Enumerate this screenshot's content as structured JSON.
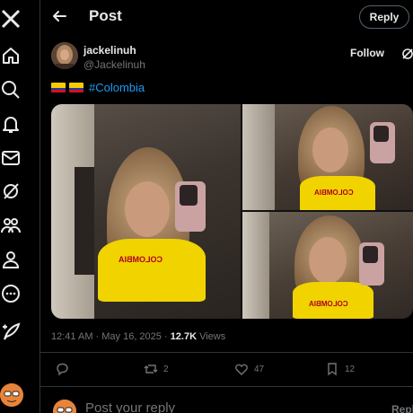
{
  "header": {
    "title": "Post",
    "reply_label": "Reply"
  },
  "author": {
    "name": "jackelinuh",
    "handle": "@Jackelinuh",
    "follow_label": "Follow"
  },
  "tweet": {
    "hashtag": "#Colombia"
  },
  "meta": {
    "time": "12:41 AM · May 16, 2025 · ",
    "views_count": "12.7K",
    "views_label": " Views"
  },
  "actions": {
    "replies": "",
    "reposts": "2",
    "likes": "47",
    "bookmarks": "12"
  },
  "composer": {
    "placeholder": "Post your reply",
    "button_label": "Reply"
  },
  "shirt_text": "COLOMBIA",
  "colors": {
    "background": "#000000",
    "accent": "#1d9bf0",
    "muted": "#71767b",
    "text": "#e7e9ea",
    "border": "#2f3336"
  },
  "icons": [
    "x-logo-icon",
    "home-icon",
    "search-icon",
    "notifications-icon",
    "messages-icon",
    "grok-icon",
    "communities-icon",
    "profile-icon",
    "more-icon",
    "post-icon",
    "back-arrow-icon",
    "reply-icon",
    "repost-icon",
    "like-icon",
    "bookmark-icon"
  ]
}
